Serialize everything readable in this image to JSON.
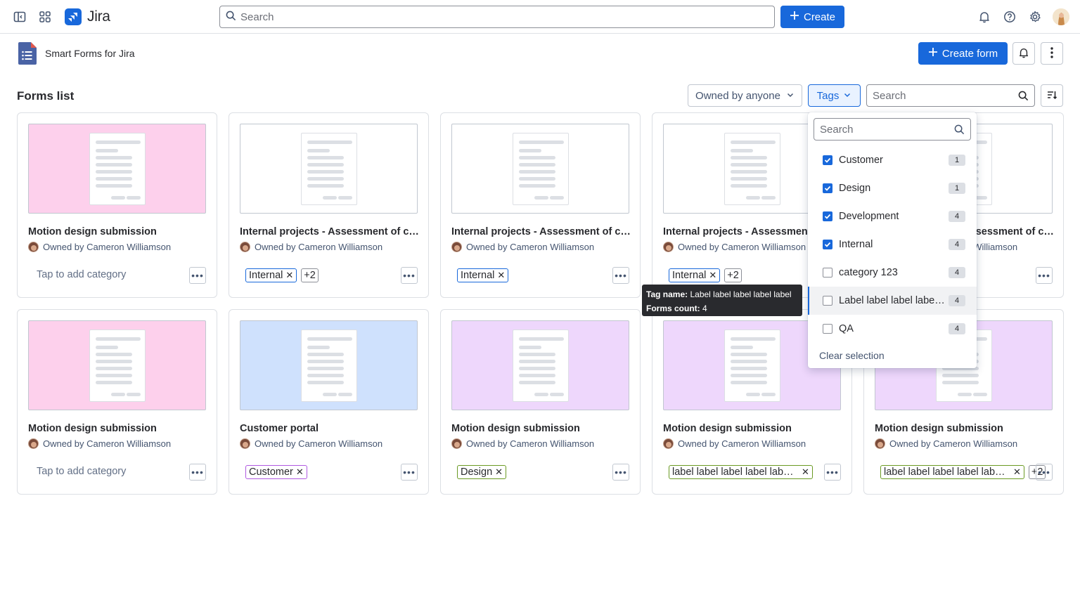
{
  "topnav": {
    "app_name": "Jira",
    "search_placeholder": "Search",
    "create_label": "Create"
  },
  "app": {
    "title": "Smart Forms for Jira",
    "create_form_label": "Create form"
  },
  "toolbar": {
    "title": "Forms list",
    "owner_filter": "Owned by anyone",
    "tags_filter": "Tags",
    "search_placeholder": "Search"
  },
  "colors": {
    "accent": "#1868db",
    "thumb_pink": "#fdd0ec",
    "thumb_blue": "#cfe1fd",
    "thumb_purple": "#eed7fc",
    "thumb_white": "#ffffff"
  },
  "cards": [
    {
      "title": "Motion design submission",
      "owner": "Owned by Cameron Williamson",
      "thumb": "pink",
      "add_category": "Tap to add category",
      "tags": [],
      "more": ""
    },
    {
      "title": "Internal projects - Assessment of capabilities",
      "owner": "Owned by Cameron Williamson",
      "thumb": "white",
      "tags": [
        {
          "label": "Internal",
          "color": "blue"
        }
      ],
      "more": "+2"
    },
    {
      "title": "Internal projects - Assessment of capabilities",
      "owner": "Owned by Cameron Williamson",
      "thumb": "white",
      "tags": [
        {
          "label": "Internal",
          "color": "blue"
        }
      ],
      "more": ""
    },
    {
      "title": "Internal projects - Assessment of capabilities",
      "owner": "Owned by Cameron Williamson",
      "thumb": "white",
      "tags": [
        {
          "label": "Internal",
          "color": "blue"
        }
      ],
      "more": "+2"
    },
    {
      "title": "Internal projects - Assessment of capabilities",
      "owner": "Owned by Cameron Williamson",
      "thumb": "white",
      "tags": [],
      "more": ""
    },
    {
      "title": "Motion design submission",
      "owner": "Owned by Cameron Williamson",
      "thumb": "pink",
      "add_category": "Tap to add category",
      "tags": [],
      "more": ""
    },
    {
      "title": "Customer portal",
      "owner": "Owned by Cameron Williamson",
      "thumb": "blue",
      "tags": [
        {
          "label": "Customer",
          "color": "purple"
        }
      ],
      "more": ""
    },
    {
      "title": "Motion design submission",
      "owner": "Owned by Cameron Williamson",
      "thumb": "purple",
      "tags": [
        {
          "label": "Design",
          "color": "green"
        }
      ],
      "more": ""
    },
    {
      "title": "Motion design submission",
      "owner": "Owned by Cameron Williamson",
      "thumb": "purple",
      "tags": [
        {
          "label": "label label label label label label",
          "color": "green",
          "truncate": true
        }
      ],
      "more": ""
    },
    {
      "title": "Motion design submission",
      "owner": "Owned by Cameron Williamson",
      "thumb": "purple",
      "tags": [
        {
          "label": "label label label label label label",
          "color": "green",
          "truncate": true
        }
      ],
      "more": "+2"
    }
  ],
  "tags_dropdown": {
    "search_placeholder": "Search",
    "items": [
      {
        "label": "Customer",
        "count": "1",
        "checked": true
      },
      {
        "label": "Design",
        "count": "1",
        "checked": true
      },
      {
        "label": "Development",
        "count": "4",
        "checked": true
      },
      {
        "label": "Internal",
        "count": "4",
        "checked": true
      },
      {
        "label": "category 123",
        "count": "4",
        "checked": false
      },
      {
        "label": "Label label label label label",
        "count": "4",
        "checked": false,
        "hover": true
      },
      {
        "label": "QA",
        "count": "4",
        "checked": false
      }
    ],
    "clear_label": "Clear selection"
  },
  "tooltip": {
    "name_key": "Tag name:",
    "name_value": "Label label label label label",
    "count_key": "Forms count:",
    "count_value": "4"
  }
}
